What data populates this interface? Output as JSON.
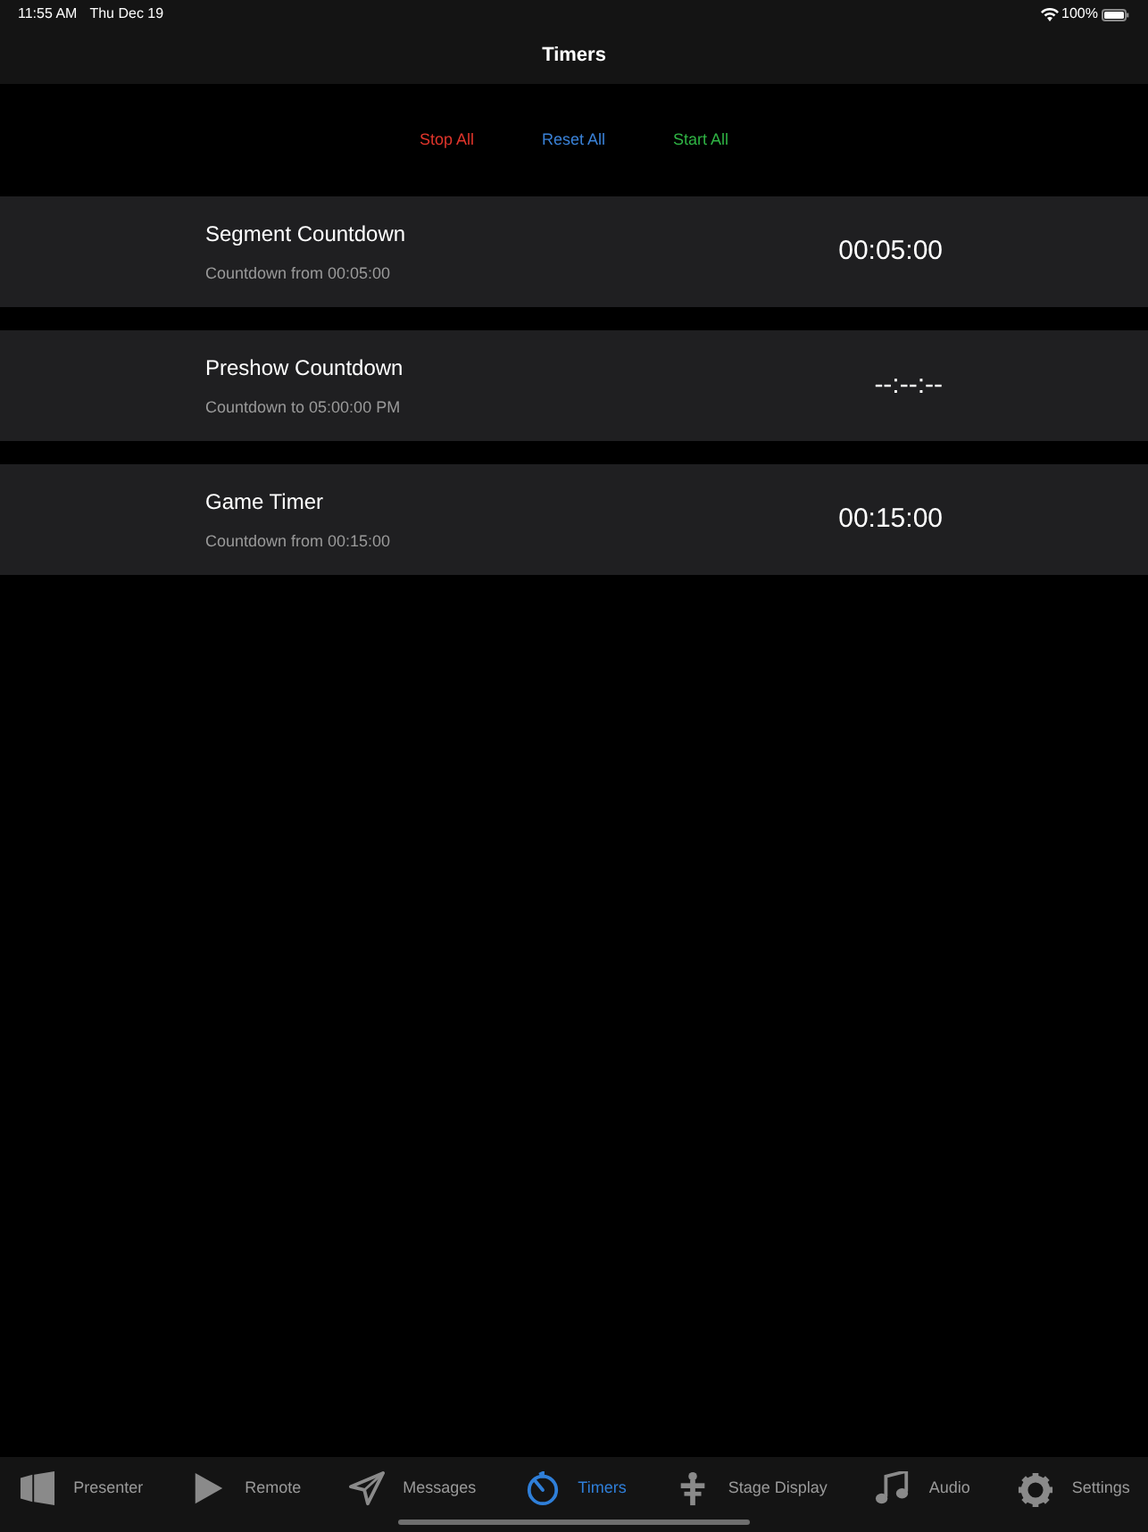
{
  "status_bar": {
    "time": "11:55 AM",
    "date": "Thu Dec 19",
    "battery": "100%"
  },
  "nav_bar": {
    "title": "Timers"
  },
  "actions": [
    {
      "label": "Stop All",
      "color": "#e0352b"
    },
    {
      "label": "Reset All",
      "color": "#3a82d8"
    },
    {
      "label": "Start All",
      "color": "#2fb344"
    }
  ],
  "timers": [
    {
      "name": "Segment Countdown",
      "detail": "Countdown from 00:05:00",
      "value": "00:05:00"
    },
    {
      "name": "Preshow Countdown",
      "detail": "Countdown to 05:00:00 PM",
      "value": "--:--:--"
    },
    {
      "name": "Game Timer",
      "detail": "Countdown from 00:15:00",
      "value": "00:15:00"
    }
  ],
  "tab_bar": [
    {
      "kind": "presenter",
      "label": "Presenter",
      "selected": false
    },
    {
      "kind": "remote",
      "label": "Remote",
      "selected": false
    },
    {
      "kind": "messages",
      "label": "Messages",
      "selected": false
    },
    {
      "kind": "timers",
      "label": "Timers",
      "selected": true
    },
    {
      "kind": "stage",
      "label": "Stage Display",
      "selected": false
    },
    {
      "kind": "audio",
      "label": "Audio",
      "selected": false
    },
    {
      "kind": "settings",
      "label": "Settings",
      "selected": false
    }
  ]
}
